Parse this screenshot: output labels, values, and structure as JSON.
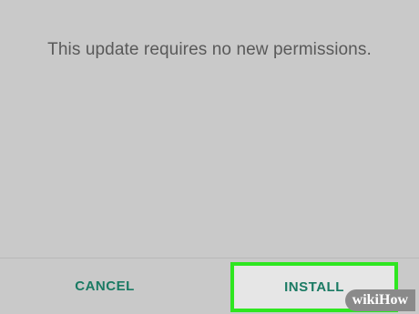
{
  "dialog": {
    "message": "This update requires no new permissions."
  },
  "buttons": {
    "cancel_label": "CANCEL",
    "install_label": "INSTALL"
  },
  "colors": {
    "background": "#c9c9c9",
    "button_text": "#1a7a63",
    "highlight": "#2ee620"
  },
  "watermark": {
    "prefix": "wiki",
    "suffix": "How"
  }
}
